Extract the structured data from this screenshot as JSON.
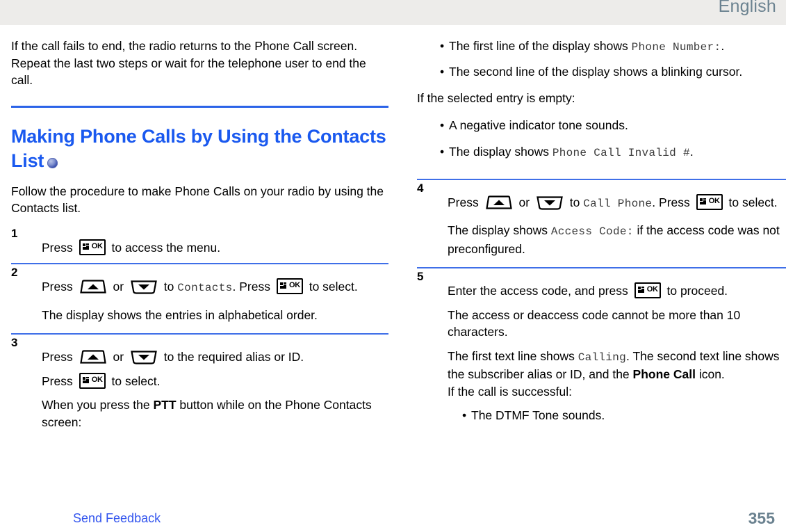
{
  "header": {
    "language": "English"
  },
  "footer": {
    "send_feedback": "Send Feedback",
    "page_number": "355"
  },
  "left_column": {
    "intro_paragraph": "If the call fails to end, the radio returns to the Phone Call screen. Repeat the last two steps or wait for the telephone user to end the call.",
    "heading": "Making Phone Calls by Using the Contacts List",
    "heading_icon": "globe-icon",
    "lead_paragraph": "Follow the procedure to make Phone Calls on your radio by using the Contacts list.",
    "steps": [
      {
        "number": "1",
        "line1_pre": "Press",
        "line1_icon": "menu-ok-key-icon",
        "line1_post": "to access the menu."
      },
      {
        "number": "2",
        "line1_pre": "Press",
        "line1_icon_up": "up-arrow-key-icon",
        "line1_or": "or",
        "line1_icon_down": "down-arrow-key-icon",
        "line1_to": "to",
        "line1_mono": "Contacts",
        "line1_press": ". Press",
        "line1_icon_ok": "menu-ok-key-icon",
        "line1_post": "to select.",
        "note": "The display shows the entries in alphabetical order."
      },
      {
        "number": "3",
        "line1_pre": "Press",
        "line1_icon_up": "up-arrow-key-icon",
        "line1_or": "or",
        "line1_icon_down": "down-arrow-key-icon",
        "line1_post": "to the required alias or ID.",
        "line2_pre": "Press",
        "line2_icon_ok": "menu-ok-key-icon",
        "line2_post": "to select.",
        "note_pre": "When you press the ",
        "note_bold": "PTT",
        "note_post": " button while on the Phone Contacts screen:"
      }
    ]
  },
  "right_column": {
    "bullets_top": [
      {
        "pre": "The first line of the display shows ",
        "mono": "Phone Number:",
        "post": "."
      },
      {
        "pre": "The second line of the display shows a blinking cursor.",
        "mono": "",
        "post": ""
      }
    ],
    "empty_entry_lead": "If the selected entry is empty:",
    "bullets_empty": [
      {
        "pre": "A negative indicator tone sounds.",
        "mono": "",
        "post": ""
      },
      {
        "pre": "The display shows ",
        "mono": "Phone Call Invalid #",
        "post": "."
      }
    ],
    "steps": [
      {
        "number": "4",
        "line1_pre": "Press",
        "line1_icon_up": "up-arrow-key-icon",
        "line1_or": "or",
        "line1_icon_down": "down-arrow-key-icon",
        "line1_to": "to",
        "line1_mono": "Call Phone",
        "line1_press": ". Press",
        "line1_icon_ok": "menu-ok-key-icon",
        "line1_post": "to select.",
        "note_pre": "The display shows ",
        "note_mono": "Access Code:",
        "note_post": " if the access code was not preconfigured."
      },
      {
        "number": "5",
        "line1_pre": "Enter the access code, and press",
        "line1_icon_ok": "menu-ok-key-icon",
        "line1_post": "to proceed.",
        "note1": "The access or deaccess code cannot be more than 10 characters.",
        "note2_pre": "The first text line shows ",
        "note2_mono": "Calling",
        "note2_mid": ". The second text line shows the subscriber alias or ID, and the ",
        "note2_bold": "Phone Call",
        "note2_post": " icon.",
        "note3": "If the call is successful:",
        "bullets": [
          {
            "text": "The DTMF Tone sounds."
          }
        ]
      }
    ]
  },
  "colors": {
    "heading_blue": "#1a59ef",
    "rule_blue": "#2b63e8",
    "link_blue": "#3355ee",
    "header_gray": "#edecea",
    "muted_slate": "#6b8290"
  }
}
